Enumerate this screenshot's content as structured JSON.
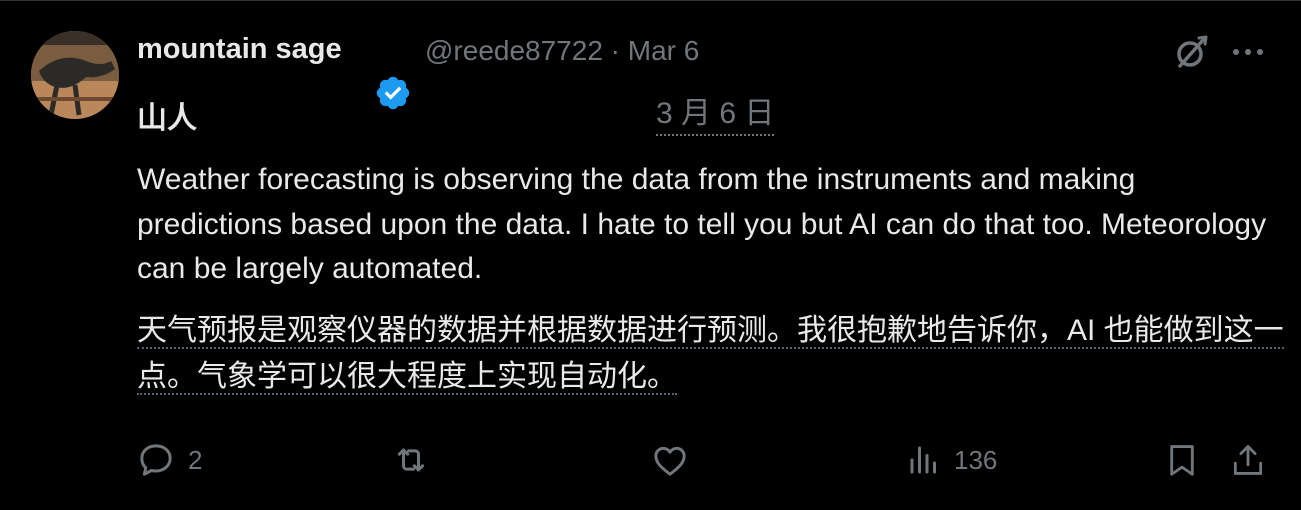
{
  "author": {
    "display_name": "mountain sage",
    "display_name_line2": "山人",
    "handle_and_date": "@reede87722 · Mar 6",
    "date_translated": "3 月 6 日",
    "verified": true,
    "avatar_icon": "avatar-photo"
  },
  "tweet": {
    "text": "Weather forecasting is observing the data from the instruments and making predictions based upon the data. I hate to tell you but AI can do that too. Meteorology can be largely automated.",
    "translation": "天气预报是观察仪器的数据并根据数据进行预测。我很抱歉地告诉你，AI 也能做到这一点。气象学可以很大程度上实现自动化。"
  },
  "actions": {
    "reply_count": "2",
    "retweet_count": "",
    "like_count": "",
    "views_count": "136"
  },
  "icons": {
    "top_right": [
      "grok-icon",
      "more-icon"
    ],
    "actions": [
      "reply-icon",
      "retweet-icon",
      "like-icon",
      "views-icon",
      "bookmark-icon",
      "share-icon"
    ]
  },
  "colors": {
    "background": "#000000",
    "text_primary": "#e7e9ea",
    "text_secondary": "#71767b",
    "verified_blue": "#1d9bf0"
  }
}
